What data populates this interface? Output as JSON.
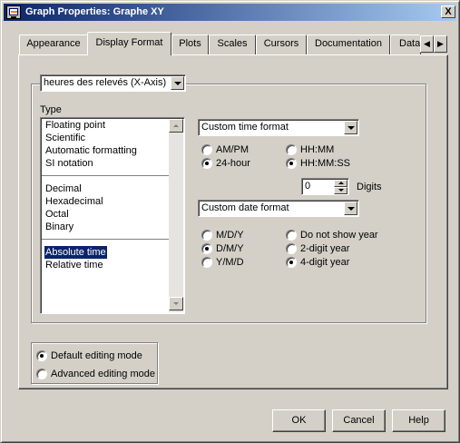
{
  "window": {
    "title": "Graph Properties: Graphe XY",
    "close_glyph": "X"
  },
  "tabs": [
    {
      "label": "Appearance",
      "active": false
    },
    {
      "label": "Display Format",
      "active": true
    },
    {
      "label": "Plots",
      "active": false
    },
    {
      "label": "Scales",
      "active": false
    },
    {
      "label": "Cursors",
      "active": false
    },
    {
      "label": "Documentation",
      "active": false
    },
    {
      "label": "Data",
      "active": false
    }
  ],
  "tab_scroll": {
    "left": "◀",
    "right": "▶"
  },
  "axis_select": {
    "value": "heures des relevés (X-Axis)"
  },
  "type": {
    "label": "Type",
    "groups": [
      [
        "Floating point",
        "Scientific",
        "Automatic formatting",
        "SI notation"
      ],
      [
        "Decimal",
        "Hexadecimal",
        "Octal",
        "Binary"
      ],
      [
        "Absolute time",
        "Relative time"
      ]
    ],
    "selected": "Absolute time"
  },
  "time_format": {
    "value": "Custom time format",
    "options": [
      {
        "label": "AM/PM",
        "checked": false
      },
      {
        "label": "HH:MM",
        "checked": false
      },
      {
        "label": "24-hour",
        "checked": true
      },
      {
        "label": "HH:MM:SS",
        "checked": true
      }
    ]
  },
  "digits": {
    "value": "0",
    "label": "Digits"
  },
  "date_format": {
    "value": "Custom date format",
    "options": [
      {
        "label": "M/D/Y",
        "checked": false
      },
      {
        "label": "Do not show year",
        "checked": false
      },
      {
        "label": "D/M/Y",
        "checked": true
      },
      {
        "label": "2-digit year",
        "checked": false
      },
      {
        "label": "Y/M/D",
        "checked": false
      },
      {
        "label": "4-digit year",
        "checked": true
      }
    ]
  },
  "editing_mode": {
    "options": [
      {
        "label": "Default editing mode",
        "checked": true
      },
      {
        "label": "Advanced editing mode",
        "checked": false
      }
    ]
  },
  "buttons": {
    "ok": "OK",
    "cancel": "Cancel",
    "help": "Help"
  }
}
